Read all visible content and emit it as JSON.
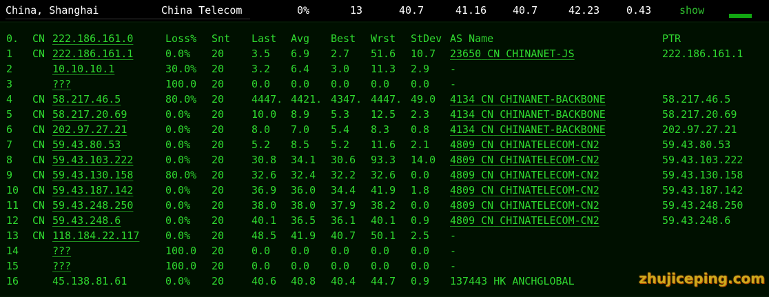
{
  "summary": {
    "location": "China, Shanghai",
    "isp": "China Telecom",
    "loss": "0%",
    "sent": "13",
    "last": "40.7",
    "avg": "41.16",
    "best": "40.7",
    "worst": "42.23",
    "stdev": "0.43",
    "show_label": "show"
  },
  "header": {
    "hop": "0.",
    "cc": "CN",
    "host": "222.186.161.0",
    "loss": "Loss%",
    "snt": "Snt",
    "last": "Last",
    "avg": "Avg",
    "best": "Best",
    "wrst": "Wrst",
    "stdev": "StDev",
    "asname": "AS Name",
    "ptr": "PTR"
  },
  "hops": [
    {
      "hop": "1",
      "cc": "CN",
      "host": "222.186.161.1",
      "host_link": true,
      "loss": "0.0%",
      "snt": "20",
      "last": "3.5",
      "avg": "6.9",
      "best": "2.7",
      "wrst": "51.6",
      "stdev": "10.7",
      "asn": "23650",
      "as_cc": "CN",
      "as_name": "CHINANET-JS",
      "as_link": true,
      "ptr": "222.186.161.1"
    },
    {
      "hop": "2",
      "cc": "",
      "host": "10.10.10.1",
      "host_link": true,
      "loss": "30.0%",
      "snt": "20",
      "last": "3.2",
      "avg": "6.4",
      "best": "3.0",
      "wrst": "11.3",
      "stdev": "2.9",
      "asn": "-",
      "as_cc": "",
      "as_name": "",
      "as_link": false,
      "ptr": ""
    },
    {
      "hop": "3",
      "cc": "",
      "host": "???",
      "host_link": true,
      "loss": "100.0",
      "snt": "20",
      "last": "0.0",
      "avg": "0.0",
      "best": "0.0",
      "wrst": "0.0",
      "stdev": "0.0",
      "asn": "-",
      "as_cc": "",
      "as_name": "",
      "as_link": false,
      "ptr": ""
    },
    {
      "hop": "4",
      "cc": "CN",
      "host": "58.217.46.5",
      "host_link": true,
      "loss": "80.0%",
      "snt": "20",
      "last": "4447.",
      "avg": "4421.",
      "best": "4347.",
      "wrst": "4447.",
      "stdev": "49.0",
      "asn": "4134",
      "as_cc": "CN",
      "as_name": "CHINANET-BACKBONE",
      "as_link": true,
      "ptr": "58.217.46.5"
    },
    {
      "hop": "5",
      "cc": "CN",
      "host": "58.217.20.69",
      "host_link": true,
      "loss": "0.0%",
      "snt": "20",
      "last": "10.0",
      "avg": "8.9",
      "best": "5.3",
      "wrst": "12.5",
      "stdev": "2.3",
      "asn": "4134",
      "as_cc": "CN",
      "as_name": "CHINANET-BACKBONE",
      "as_link": true,
      "ptr": "58.217.20.69"
    },
    {
      "hop": "6",
      "cc": "CN",
      "host": "202.97.27.21",
      "host_link": true,
      "loss": "0.0%",
      "snt": "20",
      "last": "8.0",
      "avg": "7.0",
      "best": "5.4",
      "wrst": "8.3",
      "stdev": "0.8",
      "asn": "4134",
      "as_cc": "CN",
      "as_name": "CHINANET-BACKBONE",
      "as_link": true,
      "ptr": "202.97.27.21"
    },
    {
      "hop": "7",
      "cc": "CN",
      "host": "59.43.80.53",
      "host_link": true,
      "loss": "0.0%",
      "snt": "20",
      "last": "5.2",
      "avg": "8.5",
      "best": "5.2",
      "wrst": "11.6",
      "stdev": "2.1",
      "asn": "4809",
      "as_cc": "CN",
      "as_name": "CHINATELECOM-CN2",
      "as_link": true,
      "ptr": "59.43.80.53"
    },
    {
      "hop": "8",
      "cc": "CN",
      "host": "59.43.103.222",
      "host_link": true,
      "loss": "0.0%",
      "snt": "20",
      "last": "30.8",
      "avg": "34.1",
      "best": "30.6",
      "wrst": "93.3",
      "stdev": "14.0",
      "asn": "4809",
      "as_cc": "CN",
      "as_name": "CHINATELECOM-CN2",
      "as_link": true,
      "ptr": "59.43.103.222"
    },
    {
      "hop": "9",
      "cc": "CN",
      "host": "59.43.130.158",
      "host_link": true,
      "loss": "80.0%",
      "snt": "20",
      "last": "32.6",
      "avg": "32.4",
      "best": "32.2",
      "wrst": "32.6",
      "stdev": "0.0",
      "asn": "4809",
      "as_cc": "CN",
      "as_name": "CHINATELECOM-CN2",
      "as_link": true,
      "ptr": "59.43.130.158"
    },
    {
      "hop": "10",
      "cc": "CN",
      "host": "59.43.187.142",
      "host_link": true,
      "loss": "0.0%",
      "snt": "20",
      "last": "36.9",
      "avg": "36.0",
      "best": "34.4",
      "wrst": "41.9",
      "stdev": "1.8",
      "asn": "4809",
      "as_cc": "CN",
      "as_name": "CHINATELECOM-CN2",
      "as_link": true,
      "ptr": "59.43.187.142"
    },
    {
      "hop": "11",
      "cc": "CN",
      "host": "59.43.248.250",
      "host_link": true,
      "loss": "0.0%",
      "snt": "20",
      "last": "38.0",
      "avg": "38.0",
      "best": "37.9",
      "wrst": "38.2",
      "stdev": "0.0",
      "asn": "4809",
      "as_cc": "CN",
      "as_name": "CHINATELECOM-CN2",
      "as_link": true,
      "ptr": "59.43.248.250"
    },
    {
      "hop": "12",
      "cc": "CN",
      "host": "59.43.248.6",
      "host_link": true,
      "loss": "0.0%",
      "snt": "20",
      "last": "40.1",
      "avg": "36.5",
      "best": "36.1",
      "wrst": "40.1",
      "stdev": "0.9",
      "asn": "4809",
      "as_cc": "CN",
      "as_name": "CHINATELECOM-CN2",
      "as_link": true,
      "ptr": "59.43.248.6"
    },
    {
      "hop": "13",
      "cc": "CN",
      "host": "118.184.22.117",
      "host_link": true,
      "loss": "0.0%",
      "snt": "20",
      "last": "48.5",
      "avg": "41.9",
      "best": "40.7",
      "wrst": "50.1",
      "stdev": "2.5",
      "asn": "-",
      "as_cc": "",
      "as_name": "",
      "as_link": false,
      "ptr": ""
    },
    {
      "hop": "14",
      "cc": "",
      "host": "???",
      "host_link": true,
      "loss": "100.0",
      "snt": "20",
      "last": "0.0",
      "avg": "0.0",
      "best": "0.0",
      "wrst": "0.0",
      "stdev": "0.0",
      "asn": "-",
      "as_cc": "",
      "as_name": "",
      "as_link": false,
      "ptr": ""
    },
    {
      "hop": "15",
      "cc": "",
      "host": "???",
      "host_link": true,
      "loss": "100.0",
      "snt": "20",
      "last": "0.0",
      "avg": "0.0",
      "best": "0.0",
      "wrst": "0.0",
      "stdev": "0.0",
      "asn": "-",
      "as_cc": "",
      "as_name": "",
      "as_link": false,
      "ptr": ""
    },
    {
      "hop": "16",
      "cc": "",
      "host": "45.138.81.61",
      "host_link": false,
      "loss": "0.0%",
      "snt": "20",
      "last": "40.6",
      "avg": "40.8",
      "best": "40.4",
      "wrst": "44.7",
      "stdev": "0.9",
      "asn": "137443",
      "as_cc": "HK",
      "as_name": "ANCHGLOBAL",
      "as_link": false,
      "ptr": ""
    }
  ],
  "watermark": "zhujiceping.com",
  "colors": {
    "terminal_bg": "#001000",
    "terminal_text": "#2fd92f",
    "topbar_bg": "#000000",
    "watermark": "#d9b21f"
  }
}
